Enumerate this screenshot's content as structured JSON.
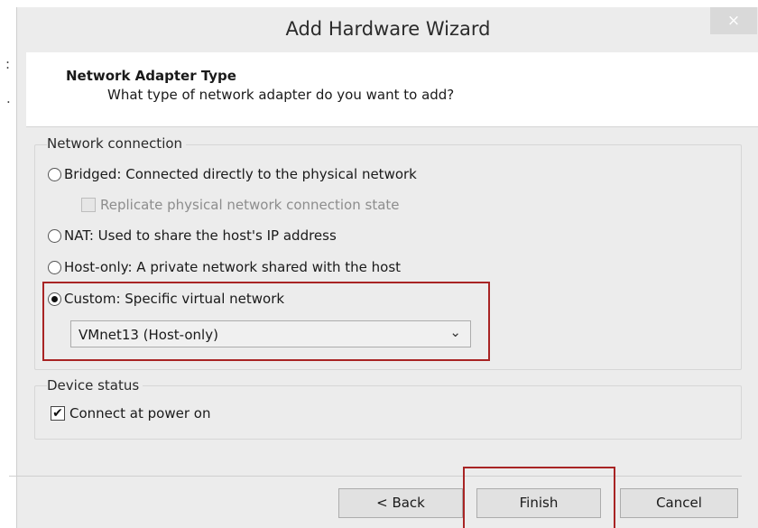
{
  "window": {
    "title": "Add Hardware Wizard",
    "close_glyph": "×"
  },
  "header": {
    "title": "Network Adapter Type",
    "subtitle": "What type of network adapter do you want to add?"
  },
  "network_connection": {
    "group_label": "Network connection",
    "options": [
      {
        "label": "Bridged: Connected directly to the physical network",
        "selected": false
      },
      {
        "label": "NAT: Used to share the host's IP address",
        "selected": false
      },
      {
        "label": "Host-only: A private network shared with the host",
        "selected": false
      },
      {
        "label": "Custom: Specific virtual network",
        "selected": true
      }
    ],
    "replicate_label": "Replicate physical network connection state",
    "replicate_checked": false,
    "replicate_enabled": false,
    "custom_network_value": "VMnet13 (Host-only)"
  },
  "device_status": {
    "group_label": "Device status",
    "connect_label": "Connect at power on",
    "connect_checked": true,
    "check_glyph": "✔"
  },
  "buttons": {
    "back": "< Back",
    "finish": "Finish",
    "cancel": "Cancel"
  },
  "icons": {
    "dropdown": "chevron-down-icon",
    "close": "close-icon"
  },
  "colors": {
    "highlight": "#a82424",
    "window_bg": "#ececec"
  },
  "stray_marks": {
    "left_colon": ":",
    "left_dot": "."
  }
}
